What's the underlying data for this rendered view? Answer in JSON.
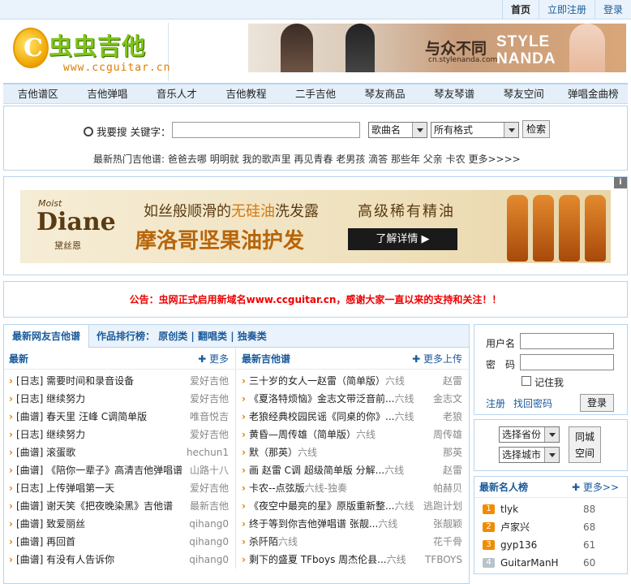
{
  "topbar": {
    "home": "首页",
    "register": "立即注册",
    "login": "登录"
  },
  "logo": {
    "icon_char": "C",
    "title": "虫虫吉他",
    "url": "www.ccguitar.cn"
  },
  "ad_top": {
    "slogan": "与众不同",
    "site": "cn.stylenanda.com",
    "brand_l1": "STYLE",
    "brand_l2": "NANDA"
  },
  "nav": [
    "吉他谱区",
    "吉他弹唱",
    "音乐人才",
    "吉他教程",
    "二手吉他",
    "琴友商品",
    "琴友琴谱",
    "琴友空间",
    "弹唱金曲榜"
  ],
  "search": {
    "label": "我要搜 关键字：",
    "type_value": "歌曲名",
    "format_value": "所有格式",
    "button": "检索",
    "hot_label": "最新热门吉他谱:",
    "hot": [
      "爸爸去哪",
      "明明就",
      "我的歌声里",
      "再见青春",
      "老男孩",
      "滴答",
      "那些年",
      "父亲",
      "卡农",
      "更多>>>>"
    ]
  },
  "ad_mid": {
    "brand_small": "Moist",
    "brand": "Diane",
    "brand_cn": "黛丝恩",
    "line1_a": "如丝般顺滑的",
    "line1_b": "无硅油",
    "line1_c": "洗发露",
    "line2": "高级稀有精油",
    "line3": "摩洛哥坚果油护发",
    "cta": "了解详情  ▶",
    "info": "i"
  },
  "notice": "公告：虫网正式启用新域名www.ccguitar.cn，感谢大家一直以来的支持和关注！！",
  "tabs": {
    "active": "最新网友吉他谱",
    "rank_label": "作品排行榜：",
    "rank1": "原创类",
    "sep": "|",
    "rank2": "翻唱类",
    "rank3": "独奏类"
  },
  "left_col": {
    "title": "最新",
    "more": "✚ 更多",
    "items": [
      {
        "text": "[日志] 需要时间和录音设备",
        "author": "爱好吉他"
      },
      {
        "text": "[日志] 继续努力",
        "author": "爱好吉他"
      },
      {
        "text": "[曲谱] 春天里 汪峰 C调简单版",
        "author": "唯音悦吉"
      },
      {
        "text": "[日志] 继续努力",
        "author": "爱好吉他"
      },
      {
        "text": "[曲谱] 滚蛋歌",
        "author": "hechun1"
      },
      {
        "text": "[曲谱] 《陪你一辈子》高清吉他弹唱谱",
        "author": "山路十八"
      },
      {
        "text": "[日志] 上传弹唱第一天",
        "author": "爱好吉他"
      },
      {
        "text": "[曲谱] 谢天笑《把夜晚染黑》吉他谱",
        "author": "最新吉他"
      },
      {
        "text": "[曲谱] 致爱丽丝",
        "author": "qihang0"
      },
      {
        "text": "[曲谱] 再回首",
        "author": "qihang0"
      },
      {
        "text": "[曲谱] 有没有人告诉你",
        "author": "qihang0"
      }
    ]
  },
  "right_col": {
    "title": "最新吉他谱",
    "more": "✚ 更多上传",
    "items": [
      {
        "text": "三十岁的女人一赵雷（简单版）",
        "tag": "六线",
        "author": "赵雷"
      },
      {
        "text": "《夏洛特烦恼》金志文带泛音前...",
        "tag": "六线",
        "author": "金志文"
      },
      {
        "text": "老狼经典校园民谣《同桌的你》...",
        "tag": "六线",
        "author": "老狼"
      },
      {
        "text": "黄昏—周传雄（简单版）",
        "tag": "六线",
        "author": "周传雄"
      },
      {
        "text": "默（那英）",
        "tag": "六线",
        "author": "那英"
      },
      {
        "text": "画 赵雷 C调 超级简单版 分解...",
        "tag": "六线",
        "author": "赵雷"
      },
      {
        "text": "卡农--点弦版",
        "tag": "六线-独奏",
        "author": "帕赫贝"
      },
      {
        "text": "《夜空中最亮的星》原版重新整...",
        "tag": "六线",
        "author": "逃跑计划"
      },
      {
        "text": "终于等到你吉他弹唱谱 张靓...",
        "tag": "六线",
        "author": "张靓颖"
      },
      {
        "text": "杀阡陌",
        "tag": "六线",
        "author": "花千骨"
      },
      {
        "text": "剩下的盛夏 TFboys 周杰伦县...",
        "tag": "六线",
        "author": "TFBOYS"
      }
    ]
  },
  "login": {
    "user_label": "用户名",
    "pass_label": "密　码",
    "remember": "记住我",
    "register": "注册",
    "forgot": "找回密码",
    "button": "登录"
  },
  "city": {
    "province": "选择省份",
    "city": "选择城市",
    "button_l1": "同城",
    "button_l2": "空间"
  },
  "rank": {
    "title": "最新名人榜",
    "more": "✚ 更多>>",
    "items": [
      {
        "n": "1",
        "name": "tlyk",
        "v": "88"
      },
      {
        "n": "2",
        "name": "卢家兴",
        "v": "68"
      },
      {
        "n": "3",
        "name": "gyp136",
        "v": "61"
      },
      {
        "n": "4",
        "name": "GuitarManH",
        "v": "60"
      }
    ]
  },
  "colors": {
    "link": "#1a5a9a",
    "hot": "#dd0000",
    "accent": "#e07b00",
    "border": "#b9d4ec"
  }
}
